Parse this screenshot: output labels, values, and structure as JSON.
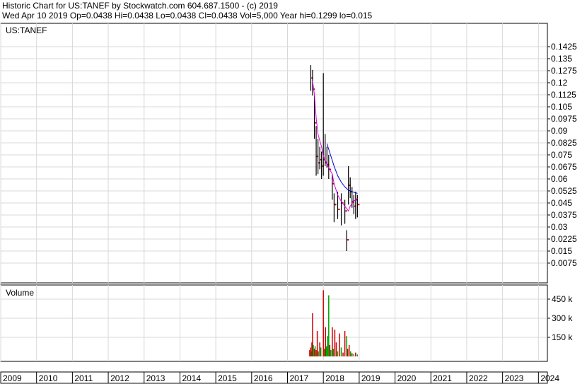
{
  "header": {
    "line1": "Historic Chart for US:TANEF by Stockwatch.com 604.687.1500 - (c) 2019",
    "line2": "Wed Apr 10 2019   Op=0.0438  Hi=0.0438  Lo=0.0438  Cl=0.0438  Vol=5,000   Year hi=0.1299   lo=0.015"
  },
  "colors": {
    "bar": "#000000",
    "ma_fast": "#e000e0",
    "ma_slow": "#0000cc",
    "close_dot": "#cc0000",
    "vol_up": "#00a000",
    "vol_down": "#cc0000",
    "grid": "#d8d8d8",
    "axis": "#000000"
  },
  "chart_data": [
    {
      "type": "line",
      "title": "US:TANEF",
      "ylim": [
        0,
        0.15
      ],
      "y_ticks": [
        "0.1425",
        "0.135",
        "0.1275",
        "0.12",
        "0.1125",
        "0.105",
        "0.0975",
        "0.09",
        "0.0825",
        "0.075",
        "0.0675",
        "0.06",
        "0.0525",
        "0.045",
        "0.0375",
        "0.03",
        "0.0225",
        "0.015",
        "0.0075"
      ],
      "x_ticks": [
        "2009",
        "2010",
        "2011",
        "2012",
        "2013",
        "2014",
        "2015",
        "2016",
        "2017",
        "2018",
        "2019",
        "2020",
        "2021",
        "2022",
        "2023",
        "2024"
      ],
      "grid": true,
      "ohlc": [
        {
          "x": 2017.65,
          "high": 0.131,
          "low": 0.115,
          "close": 0.123
        },
        {
          "x": 2017.7,
          "high": 0.128,
          "low": 0.112,
          "close": 0.116
        },
        {
          "x": 2017.75,
          "high": 0.112,
          "low": 0.085,
          "close": 0.095
        },
        {
          "x": 2017.8,
          "high": 0.093,
          "low": 0.062,
          "close": 0.074
        },
        {
          "x": 2017.85,
          "high": 0.085,
          "low": 0.063,
          "close": 0.07
        },
        {
          "x": 2017.9,
          "high": 0.08,
          "low": 0.066,
          "close": 0.072
        },
        {
          "x": 2017.95,
          "high": 0.077,
          "low": 0.06,
          "close": 0.068
        },
        {
          "x": 2018.0,
          "high": 0.126,
          "low": 0.062,
          "close": 0.072
        },
        {
          "x": 2018.05,
          "high": 0.088,
          "low": 0.068,
          "close": 0.07
        },
        {
          "x": 2018.1,
          "high": 0.08,
          "low": 0.067,
          "close": 0.069
        },
        {
          "x": 2018.15,
          "high": 0.075,
          "low": 0.06,
          "close": 0.066
        },
        {
          "x": 2018.25,
          "high": 0.063,
          "low": 0.047,
          "close": 0.057
        },
        {
          "x": 2018.3,
          "high": 0.051,
          "low": 0.033,
          "close": 0.044
        },
        {
          "x": 2018.4,
          "high": 0.052,
          "low": 0.035,
          "close": 0.041
        },
        {
          "x": 2018.5,
          "high": 0.051,
          "low": 0.031,
          "close": 0.045
        },
        {
          "x": 2018.6,
          "high": 0.047,
          "low": 0.032,
          "close": 0.04
        },
        {
          "x": 2018.65,
          "high": 0.028,
          "low": 0.015,
          "close": 0.022
        },
        {
          "x": 2018.7,
          "high": 0.068,
          "low": 0.044,
          "close": 0.056
        },
        {
          "x": 2018.75,
          "high": 0.061,
          "low": 0.048,
          "close": 0.052
        },
        {
          "x": 2018.8,
          "high": 0.055,
          "low": 0.042,
          "close": 0.046
        },
        {
          "x": 2018.85,
          "high": 0.05,
          "low": 0.038,
          "close": 0.043
        },
        {
          "x": 2018.9,
          "high": 0.052,
          "low": 0.035,
          "close": 0.047
        },
        {
          "x": 2018.95,
          "high": 0.05,
          "low": 0.036,
          "close": 0.044
        }
      ],
      "series": [
        {
          "values": [
            [
              2017.7,
              0.121
            ],
            [
              2017.75,
              0.113
            ],
            [
              2017.8,
              0.098
            ],
            [
              2017.85,
              0.088
            ],
            [
              2017.9,
              0.084
            ],
            [
              2017.95,
              0.08
            ],
            [
              2018.0,
              0.074
            ],
            [
              2018.05,
              0.072
            ],
            [
              2018.1,
              0.069
            ],
            [
              2018.15,
              0.067
            ],
            [
              2018.25,
              0.063
            ],
            [
              2018.3,
              0.057
            ],
            [
              2018.4,
              0.05
            ],
            [
              2018.5,
              0.046
            ],
            [
              2018.6,
              0.043
            ],
            [
              2018.7,
              0.04
            ],
            [
              2018.75,
              0.043
            ],
            [
              2018.85,
              0.046
            ],
            [
              2018.95,
              0.048
            ]
          ]
        },
        {
          "values": [
            [
              2018.1,
              0.082
            ],
            [
              2018.2,
              0.075
            ],
            [
              2018.3,
              0.068
            ],
            [
              2018.4,
              0.062
            ],
            [
              2018.5,
              0.058
            ],
            [
              2018.6,
              0.055
            ],
            [
              2018.7,
              0.053
            ],
            [
              2018.8,
              0.052
            ],
            [
              2018.95,
              0.051
            ]
          ]
        }
      ]
    },
    {
      "type": "bar",
      "title": "Volume",
      "ylim": [
        0,
        600000
      ],
      "y_ticks": [
        "450 k",
        "300 k",
        "150 k"
      ],
      "bars": [
        [
          2017.62,
          50000,
          "down"
        ],
        [
          2017.64,
          70000,
          "down"
        ],
        [
          2017.66,
          40000,
          "up"
        ],
        [
          2017.68,
          110000,
          "down"
        ],
        [
          2017.7,
          340000,
          "down"
        ],
        [
          2017.72,
          90000,
          "up"
        ],
        [
          2017.75,
          60000,
          "down"
        ],
        [
          2017.77,
          80000,
          "up"
        ],
        [
          2017.8,
          50000,
          "down"
        ],
        [
          2017.83,
          200000,
          "down"
        ],
        [
          2017.86,
          40000,
          "up"
        ],
        [
          2017.9,
          110000,
          "down"
        ],
        [
          2017.93,
          70000,
          "up"
        ],
        [
          2018.0,
          520000,
          "down"
        ],
        [
          2018.03,
          60000,
          "up"
        ],
        [
          2018.06,
          230000,
          "down"
        ],
        [
          2018.09,
          80000,
          "up"
        ],
        [
          2018.12,
          160000,
          "up"
        ],
        [
          2018.15,
          480000,
          "up"
        ],
        [
          2018.18,
          90000,
          "down"
        ],
        [
          2018.21,
          50000,
          "up"
        ],
        [
          2018.25,
          230000,
          "down"
        ],
        [
          2018.28,
          60000,
          "up"
        ],
        [
          2018.32,
          210000,
          "down"
        ],
        [
          2018.36,
          110000,
          "down"
        ],
        [
          2018.4,
          40000,
          "up"
        ],
        [
          2018.45,
          180000,
          "down"
        ],
        [
          2018.5,
          70000,
          "up"
        ],
        [
          2018.55,
          30000,
          "down"
        ],
        [
          2018.6,
          200000,
          "down"
        ],
        [
          2018.65,
          160000,
          "up"
        ],
        [
          2018.68,
          60000,
          "down"
        ],
        [
          2018.72,
          90000,
          "down"
        ],
        [
          2018.76,
          40000,
          "up"
        ],
        [
          2018.8,
          25000,
          "down"
        ],
        [
          2018.85,
          20000,
          "up"
        ],
        [
          2018.9,
          30000,
          "down"
        ],
        [
          2018.95,
          15000,
          "up"
        ]
      ]
    }
  ]
}
